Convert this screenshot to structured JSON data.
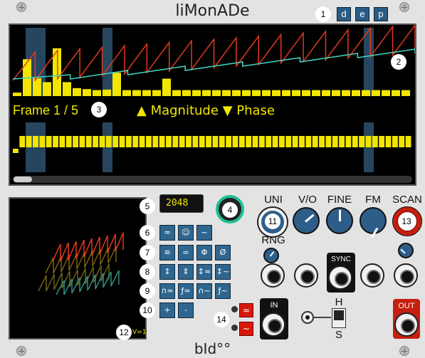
{
  "header": {
    "title": "liMonADe",
    "buttons": [
      "d",
      "e",
      "p"
    ]
  },
  "footer": {
    "brand": "bId°°"
  },
  "callouts": [
    "1",
    "2",
    "3",
    "4",
    "5",
    "6",
    "7",
    "8",
    "9",
    "10",
    "11",
    "12",
    "13",
    "14"
  ],
  "display": {
    "frame_text": "Frame 1 / 5",
    "legend_text": "▲ Magnitude ▼ Phase",
    "colors": {
      "magnitude": "#f2e600",
      "phase": "#f2e600",
      "wave_a": "#e23a1b",
      "wave_b": "#3fd6c6",
      "highlight": "#26465f"
    },
    "magnitude_bars": [
      0.07,
      0.74,
      0.36,
      0.28,
      0.96,
      0.28,
      0.16,
      0.14,
      0.12,
      0.13,
      0.47,
      0.12,
      0.12,
      0.12,
      0.12,
      0.35,
      0.12,
      0.12,
      0.12,
      0.12,
      0.12,
      0.12,
      0.12,
      0.12,
      0.12,
      0.12,
      0.12,
      0.12,
      0.12,
      0.12,
      0.12,
      0.12,
      0.12,
      0.12,
      0.12,
      0.12,
      0.12,
      0.12,
      0.12,
      0.12,
      0.12,
      0.12,
      0.12,
      0.12,
      0.12,
      0.12,
      0.12,
      0.12,
      0.12,
      0.12,
      0.12,
      0.12,
      0.12,
      0.12,
      0.12,
      0.12,
      0.12,
      0.12,
      0.12,
      0.12,
      0.12,
      0.12,
      0.12,
      0.12,
      0.12,
      0.12,
      0.12,
      0.12,
      0.12,
      0.12,
      0.12,
      0.12,
      0.12,
      0.12,
      0.12,
      0.12,
      0.12,
      0.12
    ],
    "phase_bars": [
      0.3,
      0.8,
      0.8,
      0.8,
      0.8,
      0.8,
      0.8,
      0.8,
      0.8,
      0.8,
      0.8,
      0.8,
      0.8,
      0.8,
      0.8,
      0.8,
      0.8,
      0.8,
      0.8,
      0.8,
      0.8,
      0.8,
      0.8,
      0.8,
      0.8,
      0.8,
      0.8,
      0.8,
      0.8,
      0.8,
      0.8,
      0.8,
      0.8,
      0.8,
      0.8,
      0.8,
      0.8,
      0.8,
      0.8,
      0.8,
      0.8,
      0.8,
      0.8,
      0.8,
      0.8,
      0.8,
      0.8,
      0.8,
      0.8,
      0.8,
      0.8,
      0.8,
      0.8,
      0.8,
      0.8,
      0.8,
      0.8,
      0.8,
      0.8,
      0.8
    ],
    "scroll_position": 0.0
  },
  "size_display": {
    "value": "2048"
  },
  "button_rows": [
    [
      "≈",
      "☺",
      "~"
    ],
    [
      "≡",
      "∞",
      "Φ",
      "Ø"
    ],
    [
      "↕",
      "⇕",
      "↕≈",
      "↕~"
    ],
    [
      "∩≈",
      "ƒ≈",
      "∩~",
      "ƒ~"
    ],
    [
      "+",
      "-"
    ]
  ],
  "knobs": {
    "uni_label": "UNI",
    "vo_label": "V/O",
    "fine_label": "FINE",
    "fm_label": "FM",
    "scan_label": "SCAN",
    "rng_label": "RNG"
  },
  "jacks": {
    "in_label": "IN",
    "out_label": "OUT",
    "sync_label": "SYNC"
  },
  "switch": {
    "top_label": "H",
    "bottom_label": "S"
  },
  "mini_display": {
    "tag": "V=1"
  },
  "red_buttons": [
    "≈",
    "~"
  ]
}
